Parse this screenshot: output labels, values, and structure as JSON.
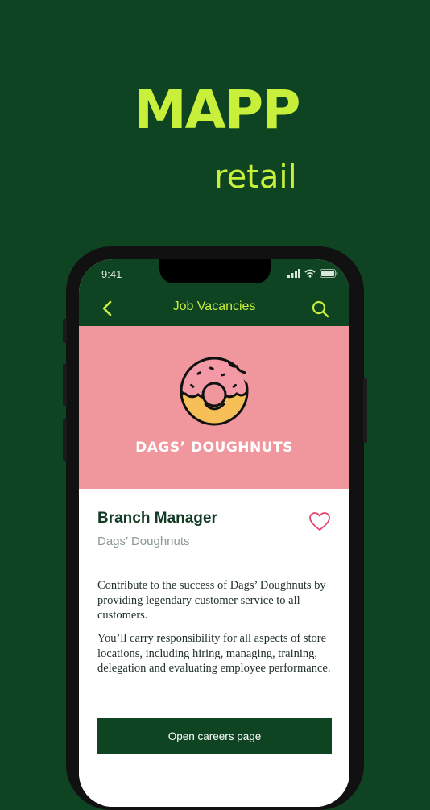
{
  "brand": {
    "logo": "MAPP",
    "subtitle": "retail"
  },
  "status_bar": {
    "time": "9:41"
  },
  "app_bar": {
    "title": "Job Vacancies",
    "back_icon": "chevron-left-icon",
    "search_icon": "search-icon"
  },
  "hero": {
    "company_logo_text": "DAGS’ DOUGHNUTS",
    "image": "doughnut-icon"
  },
  "job": {
    "title": "Branch Manager",
    "company": "Dags’ Doughnuts",
    "favorite_icon": "heart-icon",
    "description": [
      "Contribute to the success of Dags’ Doughnuts by providing legendary customer service to all customers.",
      "You’ll carry responsibility for all aspects of store locations, including hiring, managing, training, delegation and evaluating employee performance."
    ],
    "cta_label": "Open careers page"
  },
  "colors": {
    "background": "#0f4423",
    "accent": "#c8f03b",
    "hero": "#f0979d",
    "heart": "#e8436a"
  }
}
